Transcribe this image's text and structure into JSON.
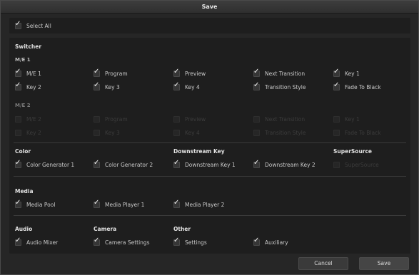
{
  "title": "Save",
  "select_all": {
    "label": "Select All",
    "checked": true
  },
  "switcher": {
    "heading": "Switcher",
    "me1": {
      "heading": "M/E 1",
      "items": [
        {
          "label": "M/E 1",
          "checked": true
        },
        {
          "label": "Program",
          "checked": true
        },
        {
          "label": "Preview",
          "checked": true
        },
        {
          "label": "Next Transition",
          "checked": true
        },
        {
          "label": "Key 1",
          "checked": true
        },
        {
          "label": "Key 2",
          "checked": true
        },
        {
          "label": "Key 3",
          "checked": true
        },
        {
          "label": "Key 4",
          "checked": true
        },
        {
          "label": "Transition Style",
          "checked": true
        },
        {
          "label": "Fade To Black",
          "checked": true
        }
      ]
    },
    "me2": {
      "heading": "M/E 2",
      "items": [
        {
          "label": "M/E 2",
          "checked": false
        },
        {
          "label": "Program",
          "checked": false
        },
        {
          "label": "Preview",
          "checked": false
        },
        {
          "label": "Next Transition",
          "checked": false
        },
        {
          "label": "Key 1",
          "checked": false
        },
        {
          "label": "Key 2",
          "checked": false
        },
        {
          "label": "Key 3",
          "checked": false
        },
        {
          "label": "Key 4",
          "checked": false
        },
        {
          "label": "Transition Style",
          "checked": false
        },
        {
          "label": "Fade To Black",
          "checked": false
        }
      ]
    }
  },
  "color": {
    "heading": "Color",
    "items": [
      {
        "label": "Color Generator 1",
        "checked": true
      },
      {
        "label": "Color Generator 2",
        "checked": true
      }
    ]
  },
  "downstream_key": {
    "heading": "Downstream Key",
    "items": [
      {
        "label": "Downstream Key 1",
        "checked": true
      },
      {
        "label": "Downstream Key 2",
        "checked": true
      }
    ]
  },
  "supersource": {
    "heading": "SuperSource",
    "items": [
      {
        "label": "SuperSource",
        "checked": false
      }
    ]
  },
  "media": {
    "heading": "Media",
    "items": [
      {
        "label": "Media Pool",
        "checked": true
      },
      {
        "label": "Media Player 1",
        "checked": true
      },
      {
        "label": "Media Player 2",
        "checked": true
      }
    ]
  },
  "audio": {
    "heading": "Audio",
    "items": [
      {
        "label": "Audio Mixer",
        "checked": true
      }
    ]
  },
  "camera": {
    "heading": "Camera",
    "items": [
      {
        "label": "Camera Settings",
        "checked": true
      }
    ]
  },
  "other": {
    "heading": "Other",
    "items": [
      {
        "label": "Settings",
        "checked": true
      },
      {
        "label": "Auxiliary",
        "checked": true
      }
    ]
  },
  "buttons": {
    "cancel": "Cancel",
    "save": "Save"
  },
  "check_glyph": "✓"
}
